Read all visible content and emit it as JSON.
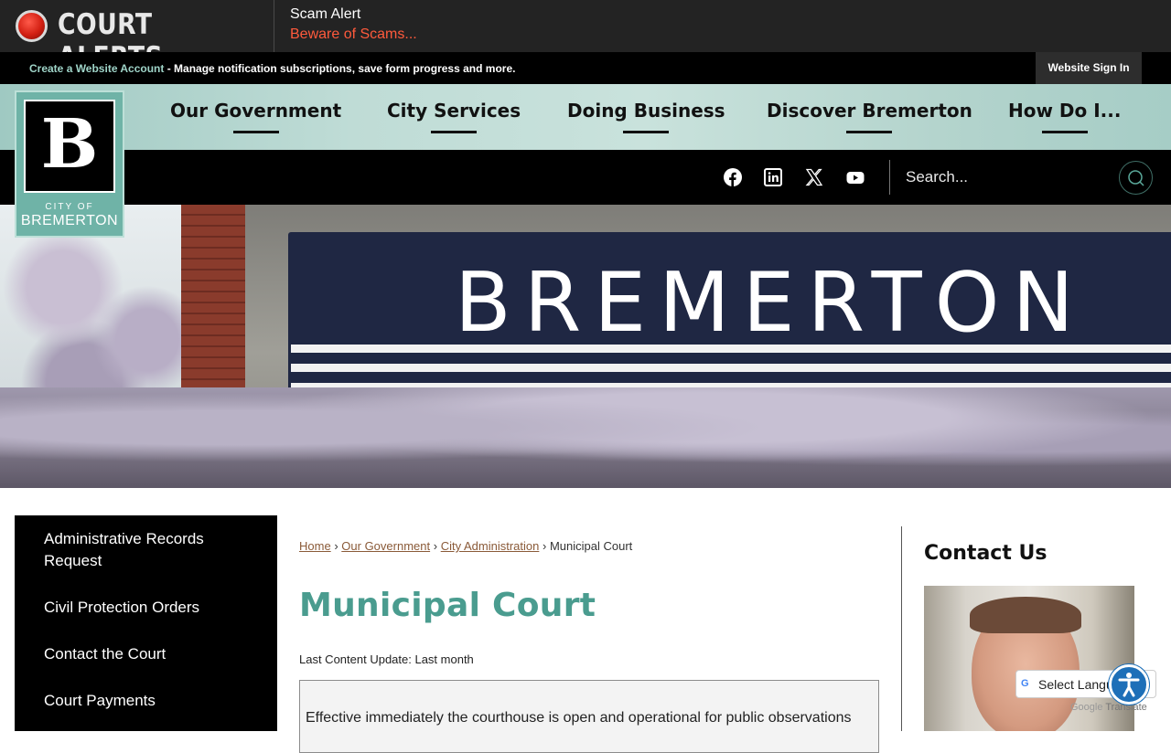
{
  "alert": {
    "title": "COURT ALERTS",
    "item_title": "Scam Alert",
    "item_subtitle": "Beware of Scams..."
  },
  "account": {
    "create_link": "Create a Website Account",
    "description": " - Manage notification subscriptions, save form progress and more.",
    "sign_in": "Website Sign In"
  },
  "logo": {
    "letter": "B",
    "city_of": "CITY OF",
    "name": "BREMERTON"
  },
  "nav": {
    "items": [
      {
        "label": "Our Government"
      },
      {
        "label": "City Services"
      },
      {
        "label": "Doing Business"
      },
      {
        "label": "Discover Bremerton"
      },
      {
        "label": "How Do I..."
      }
    ]
  },
  "social": {
    "icons": [
      "facebook-icon",
      "linkedin-icon",
      "x-icon",
      "youtube-icon"
    ]
  },
  "search": {
    "placeholder": "Search..."
  },
  "hero": {
    "sign_text": "BREMERTON"
  },
  "sidebar": {
    "items": [
      {
        "label": "Administrative Records Request"
      },
      {
        "label": "Civil Protection Orders"
      },
      {
        "label": "Contact the Court"
      },
      {
        "label": "Court Payments"
      }
    ]
  },
  "breadcrumb": {
    "items": [
      "Home",
      "Our Government",
      "City Administration"
    ],
    "current": "Municipal Court",
    "separator": "›"
  },
  "main": {
    "title": "Municipal Court",
    "last_update": "Last Content Update: Last month",
    "notice": "Effective immediately the courthouse is open and operational for public observations"
  },
  "contact": {
    "title": "Contact Us"
  },
  "translate": {
    "label": "Select Langu",
    "powered_by": "Translate",
    "google": "Google"
  },
  "colors": {
    "accent": "#4a9c8f",
    "alert_red": "#ff5a3c",
    "link_brown": "#8a5a38"
  }
}
